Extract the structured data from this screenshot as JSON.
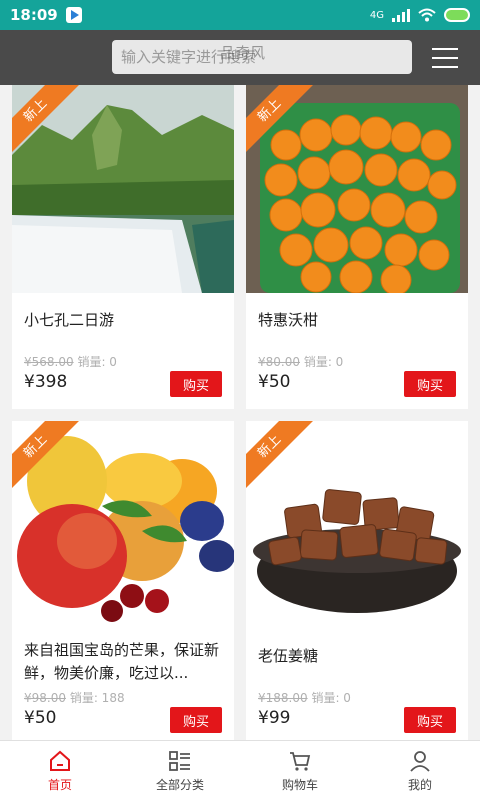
{
  "status_bar": {
    "time": "18:09",
    "network": "4G"
  },
  "header": {
    "search_placeholder": "输入关键字进行搜索",
    "title": "品奇风"
  },
  "products": [
    {
      "badge": "新上",
      "name": "小七孔二日游",
      "original_price": "¥568.00",
      "sales_label": "销量: 0",
      "price": "¥398",
      "buy_label": "购买",
      "image_icon": "landscape-waterfall"
    },
    {
      "badge": "新上",
      "name": "特惠沃柑",
      "original_price": "¥80.00",
      "sales_label": "销量: 0",
      "price": "¥50",
      "buy_label": "购买",
      "image_icon": "oranges-basket"
    },
    {
      "badge": "新上",
      "name": "来自祖国宝岛的芒果，保证新鲜，物美价廉，吃过以...",
      "original_price": "¥98.00",
      "sales_label": "销量: 188",
      "price": "¥50",
      "buy_label": "购买",
      "image_icon": "mixed-fruits"
    },
    {
      "badge": "新上",
      "name": "老伍姜糖",
      "original_price": "¥188.00",
      "sales_label": "销量: 0",
      "price": "¥99",
      "buy_label": "购买",
      "image_icon": "ginger-candy-bowl"
    }
  ],
  "bottom_nav": [
    {
      "label": "首页",
      "icon": "home-icon",
      "active": true
    },
    {
      "label": "全部分类",
      "icon": "category-icon",
      "active": false
    },
    {
      "label": "购物车",
      "icon": "cart-icon",
      "active": false
    },
    {
      "label": "我的",
      "icon": "user-icon",
      "active": false
    }
  ],
  "colors": {
    "status_bar": "#14a49a",
    "header": "#4a4a4a",
    "accent_red": "#e3161a",
    "badge_orange": "#ef7a22"
  }
}
